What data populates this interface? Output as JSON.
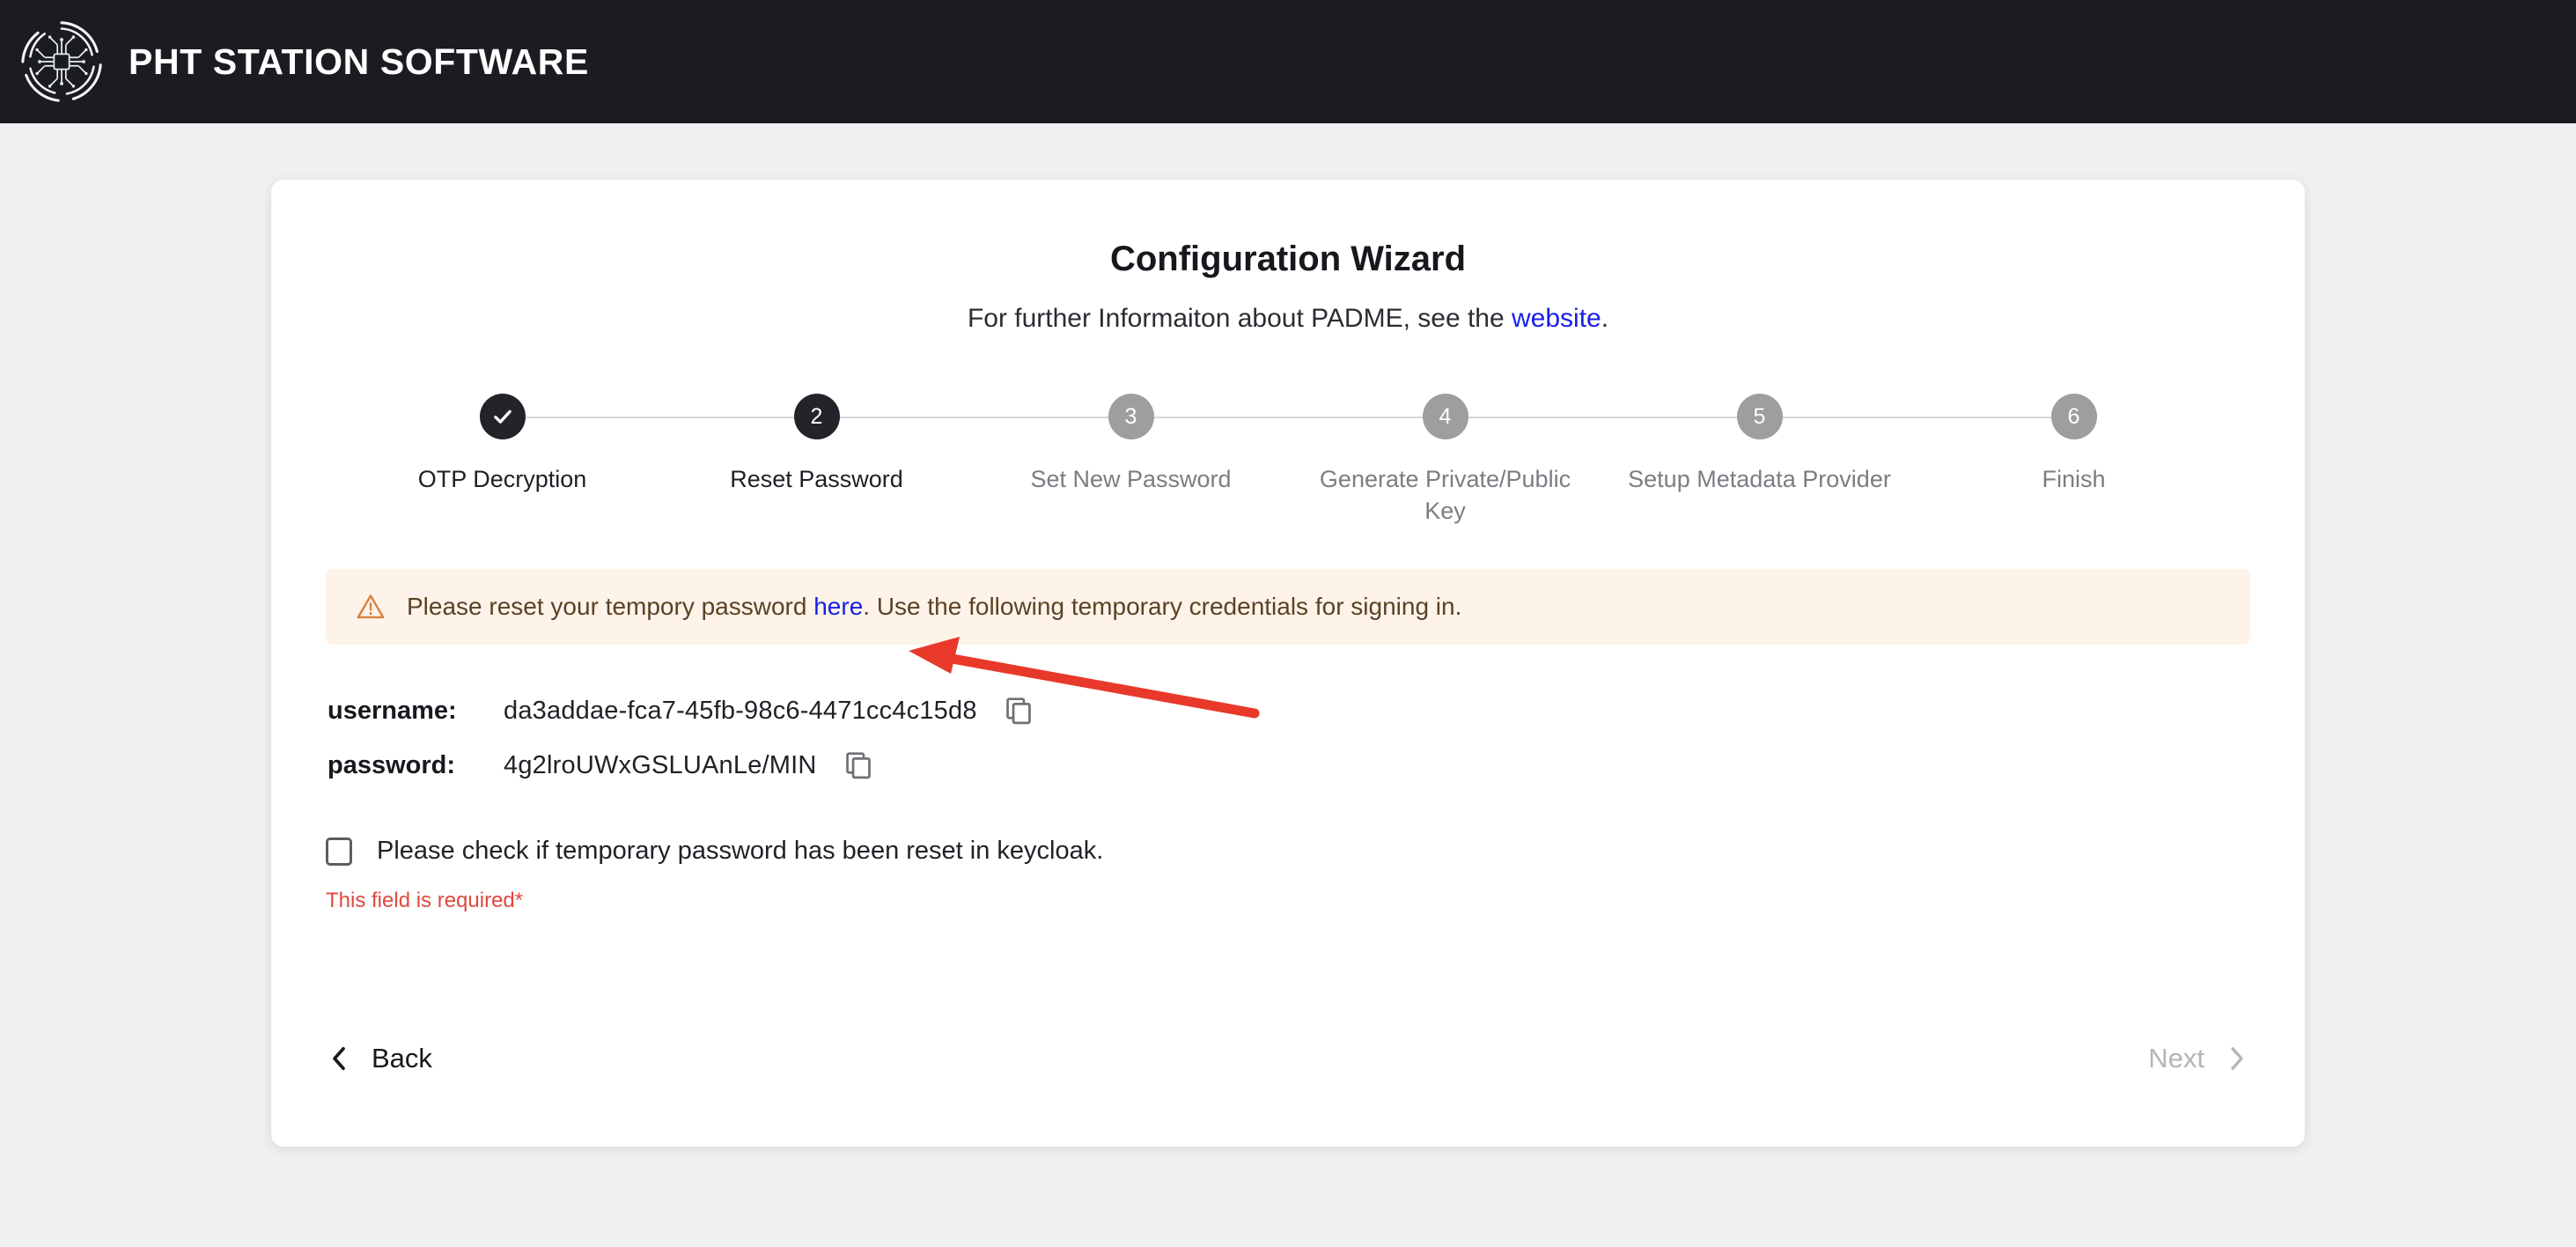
{
  "header": {
    "logo_icon": "circuit-chip-logo-icon",
    "title": "PHT STATION SOFTWARE",
    "background_color": "#1b1c21"
  },
  "card": {
    "title": "Configuration Wizard",
    "subtitle_prefix": "For further Informaiton about PADME, see the ",
    "subtitle_link": "website",
    "subtitle_suffix": "."
  },
  "stepper": {
    "current_step": 2,
    "steps": [
      {
        "number": "1",
        "label": "OTP Decryption",
        "state": "done",
        "icon": "check-icon"
      },
      {
        "number": "2",
        "label": "Reset Password",
        "state": "active",
        "icon": ""
      },
      {
        "number": "3",
        "label": "Set New Password",
        "state": "todo",
        "icon": ""
      },
      {
        "number": "4",
        "label": "Generate Private/Public Key",
        "state": "todo",
        "icon": ""
      },
      {
        "number": "5",
        "label": "Setup Metadata Provider",
        "state": "todo",
        "icon": ""
      },
      {
        "number": "6",
        "label": "Finish",
        "state": "todo",
        "icon": ""
      }
    ]
  },
  "alert": {
    "icon": "warning-triangle-icon",
    "text_before_link": "Please reset your tempory password ",
    "link_text": "here",
    "text_after_link": ". Use the following temporary credentials for signing in.",
    "background_color": "#fdf3e9",
    "icon_color": "#d9813f",
    "text_color": "#5b4224"
  },
  "credentials": [
    {
      "key": "username:",
      "value": "da3addae-fca7-45fb-98c6-4471cc4c15d8",
      "copy_icon": "copy-icon"
    },
    {
      "key": "password:",
      "value": "4g2lroUWxGSLUAnLe/MIN",
      "copy_icon": "copy-icon"
    }
  ],
  "confirm": {
    "checked": false,
    "label": "Please check if temporary password has been reset in keycloak.",
    "error": "This field is required*",
    "error_color": "#e0483c"
  },
  "navigation": {
    "back_label": "Back",
    "back_icon": "chevron-left-icon",
    "next_label": "Next",
    "next_icon": "chevron-right-icon",
    "next_disabled": true
  },
  "annotation": {
    "arrow_color": "#e8392a",
    "points_to": "here-link"
  }
}
